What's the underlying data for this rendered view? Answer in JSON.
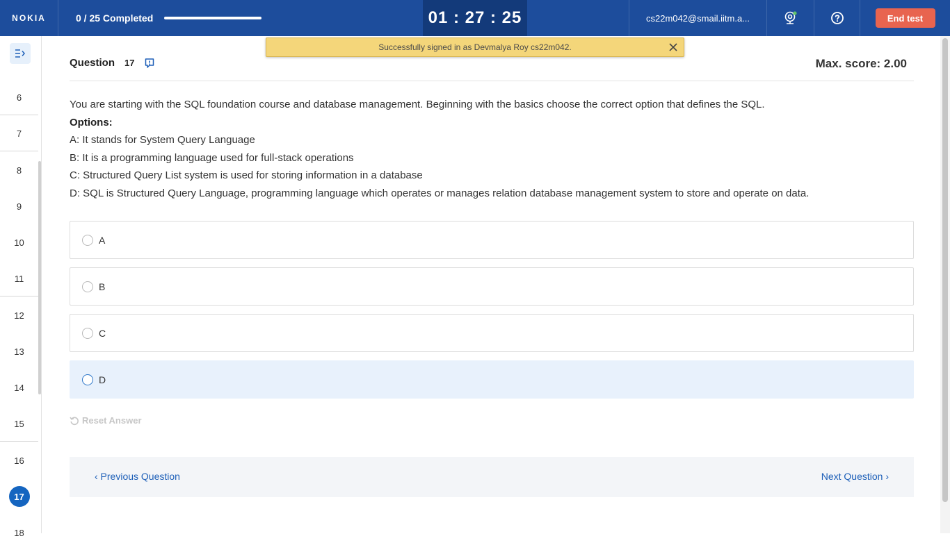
{
  "header": {
    "logo": "NOKIA",
    "progress_text": "0 / 25 Completed",
    "progress_fraction": 0,
    "timer": "01 : 27 : 25",
    "email": "cs22m042@smail.iitm.a...",
    "end_test_label": "End test"
  },
  "toast": {
    "message": "Successfully signed in as Devmalya Roy cs22m042."
  },
  "sidebar": {
    "questions": [
      "6",
      "7",
      "8",
      "9",
      "10",
      "11",
      "12",
      "13",
      "14",
      "15",
      "16",
      "17",
      "18"
    ],
    "active": "17"
  },
  "question": {
    "label": "Question",
    "number": "17",
    "max_score": "Max. score: 2.00",
    "text": "You are starting with the SQL foundation course and database management. Beginning with the basics choose the correct option that defines the SQL.",
    "options_label": "Options:",
    "option_lines": [
      "A: It stands for System Query Language",
      "B: It is a programming language used for full-stack operations",
      "C: Structured Query List system is used for storing information in a database",
      "D: SQL is Structured Query Language, programming language which operates or manages relation database management system to store and operate on data."
    ],
    "choices": [
      "A",
      "B",
      "C",
      "D"
    ]
  },
  "actions": {
    "reset_label": "Reset Answer",
    "prev_label": "‹ Previous Question",
    "next_label": "Next Question ›"
  },
  "colors": {
    "header_bg": "#1d4d9c",
    "timer_bg": "#133a7a",
    "end_button": "#e8644f",
    "accent": "#1565c0",
    "toast_bg": "#f4d67a"
  }
}
